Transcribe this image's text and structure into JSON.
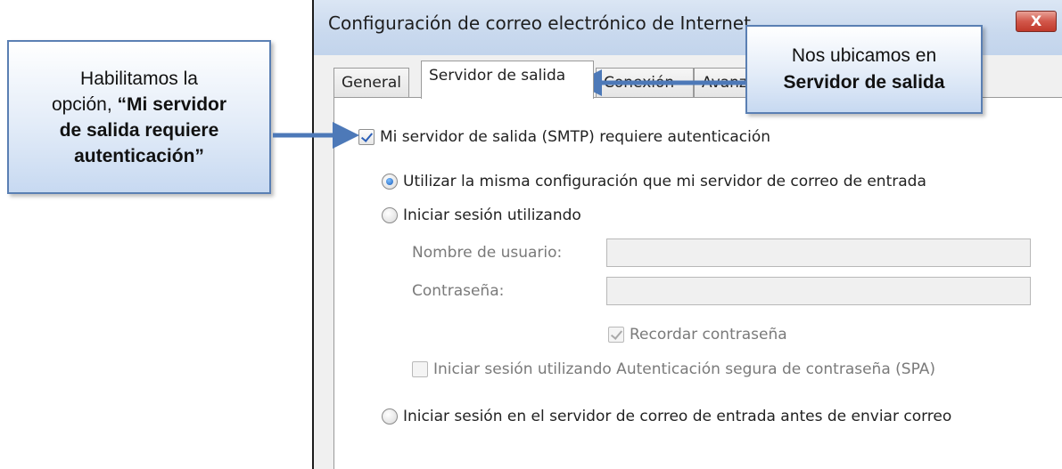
{
  "window": {
    "title": "Configuración de correo electrónico de Internet",
    "close_label": "X"
  },
  "tabs": [
    {
      "label": "General",
      "active": false
    },
    {
      "label": "Servidor de salida",
      "active": true
    },
    {
      "label": "Conexión",
      "active": false
    },
    {
      "label": "Avanzadas",
      "active": false
    }
  ],
  "form": {
    "smtp_auth": {
      "label": "Mi servidor de salida (SMTP) requiere autenticación",
      "checked": true
    },
    "same_config": {
      "label": "Utilizar la misma configuración que mi servidor de correo de entrada",
      "selected": true
    },
    "login_using": {
      "label": "Iniciar sesión utilizando",
      "selected": false
    },
    "username": {
      "label": "Nombre de usuario:",
      "value": ""
    },
    "password": {
      "label": "Contraseña:",
      "value": ""
    },
    "remember_password": {
      "label": "Recordar contraseña",
      "checked": true,
      "enabled": false
    },
    "spa": {
      "label": "Iniciar sesión utilizando Autenticación segura de contraseña (SPA)",
      "checked": false,
      "enabled": false
    },
    "login_before_send": {
      "label": "Iniciar sesión en el servidor de correo de entrada antes de enviar correo",
      "selected": false
    }
  },
  "callouts": {
    "left": {
      "line1": "Habilitamos la",
      "line2_prefix": "opción, ",
      "line2_bold": "“Mi servidor",
      "line3_bold": "de salida requiere",
      "line4_bold": "autenticación”"
    },
    "right": {
      "line1": "Nos ubicamos en",
      "line2_bold": "Servidor de salida"
    }
  },
  "colors": {
    "callout_border": "#5a7fb3",
    "arrow": "#4d79b8",
    "close_button": "#c0392b"
  }
}
